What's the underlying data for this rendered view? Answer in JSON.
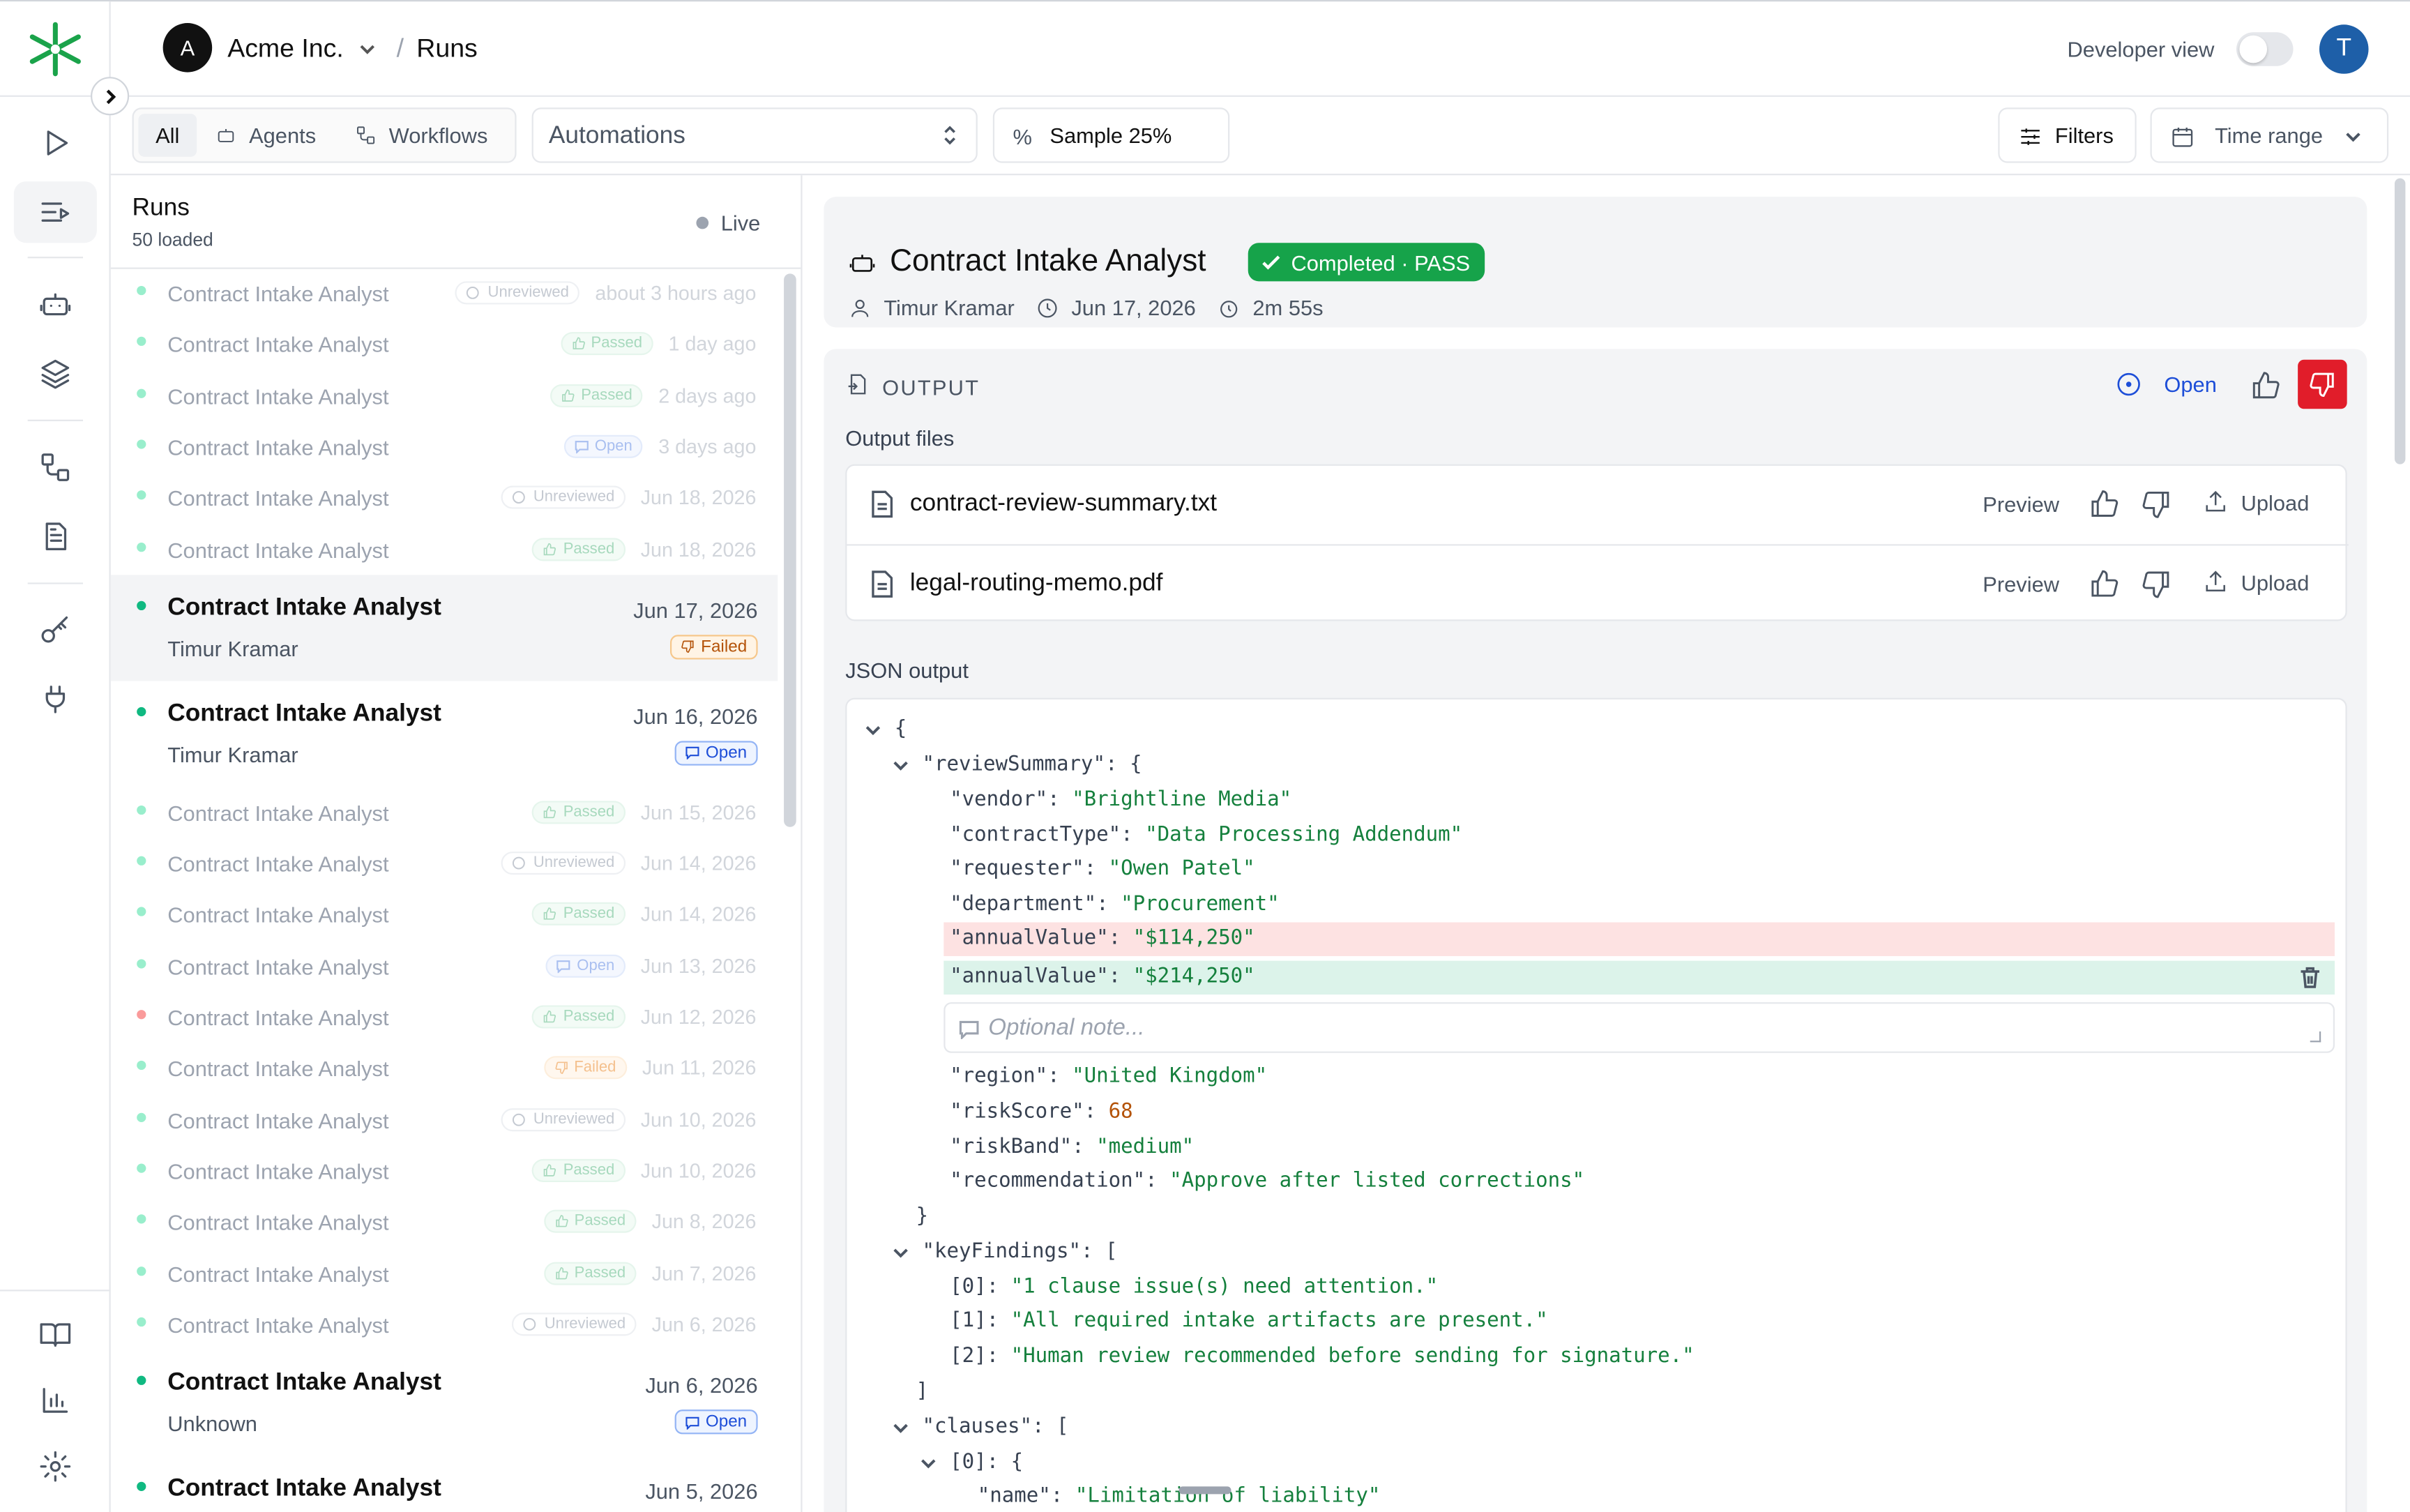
{
  "header": {
    "org_initial": "A",
    "org_name": "Acme Inc.",
    "breadcrumb_sep": "/",
    "breadcrumb_current": "Runs",
    "developer_view_label": "Developer view",
    "developer_view_on": false,
    "user_initial": "T"
  },
  "toolbar": {
    "tabs": [
      {
        "label": "All",
        "active": true
      },
      {
        "label": "Agents",
        "icon": "robot-icon"
      },
      {
        "label": "Workflows",
        "icon": "workflow-icon"
      }
    ],
    "automations_select": "Automations",
    "sample_icon": "%",
    "sample_label": "Sample 25%",
    "filters_label": "Filters",
    "time_range_label": "Time range"
  },
  "runs": {
    "title": "Runs",
    "loaded": "50 loaded",
    "live_label": "Live",
    "items": [
      {
        "name": "Contract Intake Analyst",
        "status": "Unreviewed",
        "when": "about 3 hours ago"
      },
      {
        "name": "Contract Intake Analyst",
        "status": "Passed",
        "when": "1 day ago"
      },
      {
        "name": "Contract Intake Analyst",
        "status": "Passed",
        "when": "2 days ago"
      },
      {
        "name": "Contract Intake Analyst",
        "status": "Open",
        "when": "3 days ago"
      },
      {
        "name": "Contract Intake Analyst",
        "status": "Unreviewed",
        "when": "Jun 18, 2026"
      },
      {
        "name": "Contract Intake Analyst",
        "status": "Passed",
        "when": "Jun 18, 2026"
      },
      {
        "name": "Contract Intake Analyst",
        "user": "Timur Kramar",
        "status": "Failed",
        "when": "Jun 17, 2026",
        "selected": true
      },
      {
        "name": "Contract Intake Analyst",
        "user": "Timur Kramar",
        "status": "Open",
        "when": "Jun 16, 2026"
      },
      {
        "name": "Contract Intake Analyst",
        "status": "Passed",
        "when": "Jun 15, 2026"
      },
      {
        "name": "Contract Intake Analyst",
        "status": "Unreviewed",
        "when": "Jun 14, 2026"
      },
      {
        "name": "Contract Intake Analyst",
        "status": "Passed",
        "when": "Jun 14, 2026"
      },
      {
        "name": "Contract Intake Analyst",
        "status": "Open",
        "when": "Jun 13, 2026"
      },
      {
        "name": "Contract Intake Analyst",
        "status": "Passed",
        "when": "Jun 12, 2026",
        "dot": "red"
      },
      {
        "name": "Contract Intake Analyst",
        "status": "Failed",
        "when": "Jun 11, 2026"
      },
      {
        "name": "Contract Intake Analyst",
        "status": "Unreviewed",
        "when": "Jun 10, 2026"
      },
      {
        "name": "Contract Intake Analyst",
        "status": "Passed",
        "when": "Jun 10, 2026"
      },
      {
        "name": "Contract Intake Analyst",
        "status": "Passed",
        "when": "Jun 8, 2026"
      },
      {
        "name": "Contract Intake Analyst",
        "status": "Passed",
        "when": "Jun 7, 2026"
      },
      {
        "name": "Contract Intake Analyst",
        "status": "Unreviewed",
        "when": "Jun 6, 2026"
      },
      {
        "name": "Contract Intake Analyst",
        "user": "Unknown",
        "status": "Open",
        "when": "Jun 6, 2026"
      },
      {
        "name": "Contract Intake Analyst",
        "when": "Jun 5, 2026"
      }
    ]
  },
  "detail": {
    "title": "Contract Intake Analyst",
    "status": "Completed · PASS",
    "user": "Timur Kramar",
    "date": "Jun 17, 2026",
    "duration": "2m 55s",
    "output_label": "OUTPUT",
    "open_label": "Open",
    "output_files_label": "Output files",
    "files": [
      {
        "name": "contract-review-summary.txt",
        "preview": "Preview",
        "upload": "Upload"
      },
      {
        "name": "legal-routing-memo.pdf",
        "preview": "Preview",
        "upload": "Upload"
      }
    ],
    "json_output_label": "JSON output",
    "note_placeholder": "Optional note...",
    "json": {
      "vendor": "\"Brightline Media\"",
      "contractType": "\"Data Processing Addendum\"",
      "requester": "\"Owen Patel\"",
      "department": "\"Procurement\"",
      "annualValue_old": "\"$114,250\"",
      "annualValue_new": "\"$214,250\"",
      "region": "\"United Kingdom\"",
      "riskScore": "68",
      "riskBand": "\"medium\"",
      "recommendation": "\"Approve after listed corrections\"",
      "keyFindings": [
        "\"1 clause issue(s) need attention.\"",
        "\"All required intake artifacts are present.\"",
        "\"Human review recommended before sending for signature.\""
      ],
      "clause0_name": "\"Limitation of liability\""
    }
  },
  "colors": {
    "accent_green": "#16a34a",
    "thumb_down_red": "#e11d2a",
    "link_blue": "#1d4ed8",
    "string_green": "#15803d",
    "number_orange": "#b45309"
  }
}
